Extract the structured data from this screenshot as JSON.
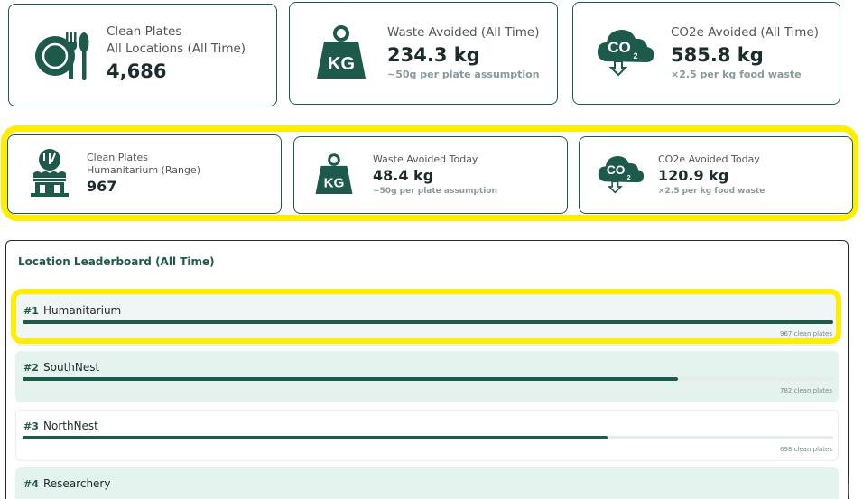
{
  "row1": [
    {
      "label1": "Clean Plates",
      "label2": "All Locations (All Time)",
      "value": "4,686",
      "note": "",
      "icon": "plate-cutlery-icon"
    },
    {
      "label1": "Waste Avoided (All Time)",
      "value": "234.3 kg",
      "note": "~50g per plate assumption",
      "icon": "kg-weight-icon"
    },
    {
      "label1": "CO2e Avoided (All Time)",
      "value": "585.8 kg",
      "note": "×2.5 per kg food waste",
      "icon": "co2-cloud-icon"
    }
  ],
  "row2": [
    {
      "label1": "Clean Plates",
      "label2": "Humanitarium (Range)",
      "value": "967",
      "note": "",
      "icon": "restaurant-building-icon"
    },
    {
      "label1": "Waste Avoided Today",
      "value": "48.4 kg",
      "note": "~50g per plate assumption",
      "icon": "kg-weight-icon"
    },
    {
      "label1": "CO2e Avoided Today",
      "value": "120.9 kg",
      "note": "×2.5 per kg food waste",
      "icon": "co2-cloud-icon"
    }
  ],
  "leaderboard": {
    "title": "Location Leaderboard (All Time)",
    "rows": [
      {
        "rank": "#1",
        "name": "Humanitarium",
        "count": "967 clean plates",
        "fraction": 1.0
      },
      {
        "rank": "#2",
        "name": "SouthNest",
        "count": "782 clean plates",
        "fraction": 0.809
      },
      {
        "rank": "#3",
        "name": "NorthNest",
        "count": "698 clean plates",
        "fraction": 0.722
      },
      {
        "rank": "#4",
        "name": "Researchery",
        "count": "",
        "fraction": 0
      }
    ]
  },
  "colors": {
    "brand": "#1e5a4c",
    "highlight": "#ffee00"
  }
}
